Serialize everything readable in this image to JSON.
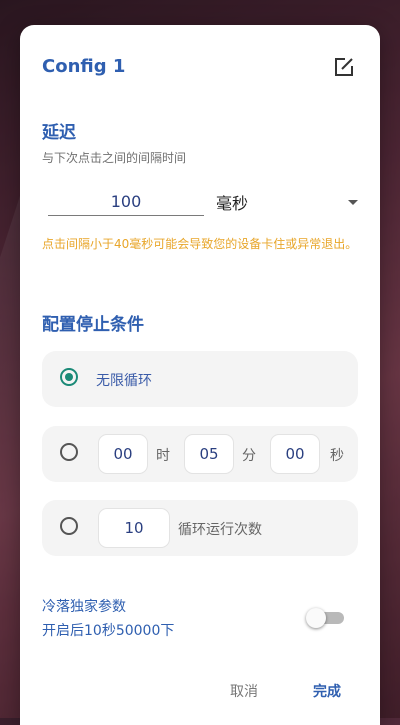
{
  "dialog": {
    "title": "Config 1",
    "edit_icon": "edit-icon"
  },
  "delay": {
    "title": "延迟",
    "description": "与下次点击之间的间隔时间",
    "value": "100",
    "unit": "毫秒",
    "warning": "点击间隔小于40毫秒可能会导致您的设备卡住或异常退出。"
  },
  "stop_condition": {
    "title": "配置停止条件",
    "infinite": {
      "label": "无限循环",
      "selected": true
    },
    "timer": {
      "hours": "00",
      "hours_unit": "时",
      "minutes": "05",
      "minutes_unit": "分",
      "seconds": "00",
      "seconds_unit": "秒",
      "selected": false
    },
    "count": {
      "value": "10",
      "label": "循环运行次数",
      "selected": false
    }
  },
  "cold_param": {
    "line1": "冷落独家参数",
    "line2": "开启后10秒50000下",
    "enabled": false
  },
  "actions": {
    "cancel_label": "取消",
    "done_label": "完成"
  },
  "colors": {
    "accent_blue": "#2f5fb0",
    "radio_green": "#1b8a77",
    "warning_orange": "#e8a62a"
  }
}
